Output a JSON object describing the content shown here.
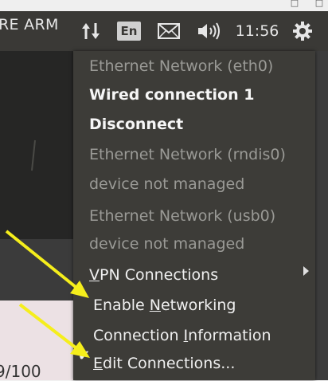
{
  "panel": {
    "app_title": "RE ARM",
    "input_method": "En",
    "clock": "11:56"
  },
  "app": {
    "counter": "9/100"
  },
  "network_menu": {
    "items": [
      {
        "label": "Ethernet Network (eth0)",
        "style": "dim"
      },
      {
        "label": "Wired connection 1",
        "style": "bold"
      },
      {
        "label": "Disconnect",
        "style": "bold"
      },
      {
        "label": "Ethernet Network (rndis0)",
        "style": "dim"
      },
      {
        "label": "device not managed",
        "style": "dim"
      },
      {
        "label": "Ethernet Network (usb0)",
        "style": "dim"
      },
      {
        "label": "device not managed",
        "style": "dim"
      },
      {
        "label_underline": "V",
        "label_rest": "PN Connections",
        "has_submenu": true
      },
      {
        "label_pre": "Enable ",
        "label_underline": "N",
        "label_rest": "etworking",
        "checked": true
      },
      {
        "label_pre": "Connection ",
        "label_underline": "I",
        "label_rest": "nformation"
      },
      {
        "label_underline": "E",
        "label_rest": "dit Connections..."
      }
    ],
    "check_mark": "✔"
  },
  "colors": {
    "panel_bg": "#3a3936",
    "menu_bg": "#3d3c38",
    "annotation_arrow": "#f5ee1c"
  },
  "icons": [
    "network-updown-icon",
    "keyboard-layout-icon",
    "mail-icon",
    "volume-icon",
    "gear-icon"
  ]
}
